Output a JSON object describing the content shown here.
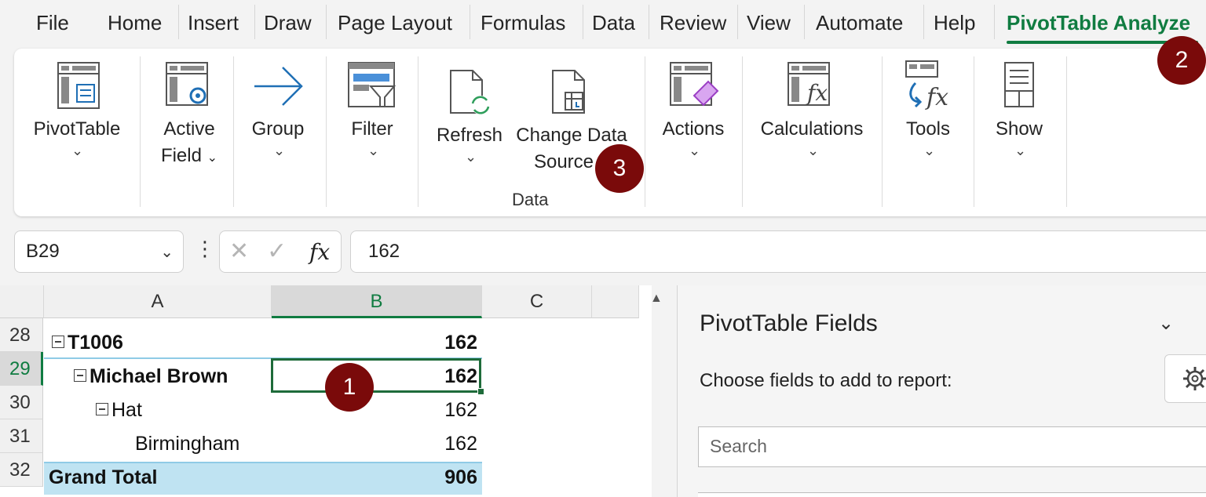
{
  "menu": {
    "tabs": [
      "File",
      "Home",
      "Insert",
      "Draw",
      "Page Layout",
      "Formulas",
      "Data",
      "Review",
      "View",
      "Automate",
      "Help"
    ],
    "active_tab": "PivotTable Analyze"
  },
  "ribbon": {
    "pivottable": "PivotTable",
    "active_field_1": "Active",
    "active_field_2": "Field",
    "group": "Group",
    "filter": "Filter",
    "refresh": "Refresh",
    "change_data_1": "Change Data",
    "change_data_2": "Source",
    "data_group": "Data",
    "actions": "Actions",
    "calculations": "Calculations",
    "tools": "Tools",
    "show": "Show",
    "chevron": "⌄",
    "field_chevron": "⌄"
  },
  "badges": {
    "one": "1",
    "two": "2",
    "three": "3"
  },
  "formula_bar": {
    "name_box": "B29",
    "formula": "162",
    "fx": "fx"
  },
  "grid": {
    "columns": [
      "A",
      "B",
      "C"
    ],
    "rows": [
      {
        "num": "28",
        "label": "T1006",
        "value": "162"
      },
      {
        "num": "29",
        "label": "Michael Brown",
        "value": "162"
      },
      {
        "num": "30",
        "label": "Hat",
        "value": "162"
      },
      {
        "num": "31",
        "label": "Birmingham",
        "value": "162"
      },
      {
        "num": "32",
        "label": "Grand Total",
        "value": "906"
      }
    ]
  },
  "panel": {
    "title": "PivotTable Fields",
    "subtitle": "Choose fields to add to report:",
    "search_placeholder": "Search"
  },
  "colors": {
    "accent": "#107c41",
    "badge": "#7a0a0a",
    "pivot_highlight": "#bfe3f2"
  }
}
